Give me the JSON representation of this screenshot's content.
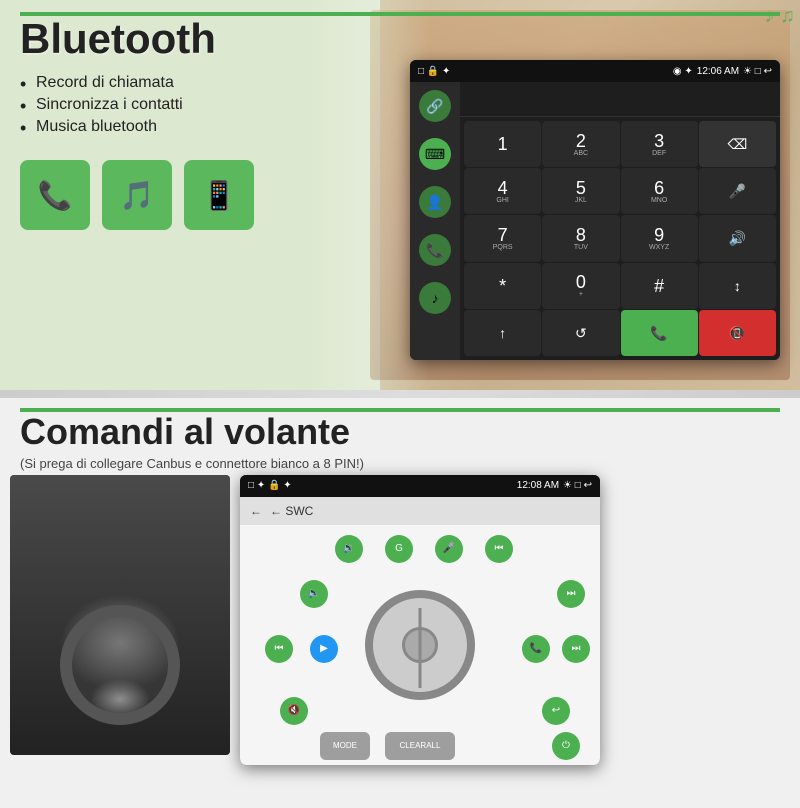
{
  "bluetooth": {
    "title": "Bluetooth",
    "features": [
      "Record di chiamata",
      "Sincronizza i contatti",
      "Musica bluetooth"
    ],
    "icons": [
      "📞",
      "🎵",
      "📱"
    ],
    "phone_status_time": "12:06 AM",
    "phone_status_left": "□ 🔒 ✦",
    "phone_status_right": "◉ ✦ ☀ □ ↩",
    "keypad": [
      {
        "num": "1",
        "sub": ""
      },
      {
        "num": "2",
        "sub": "ABC"
      },
      {
        "num": "3",
        "sub": "DEF"
      },
      {
        "num": "⌫",
        "sub": "",
        "type": "del"
      },
      {
        "num": "4",
        "sub": "GHI"
      },
      {
        "num": "5",
        "sub": "JKL"
      },
      {
        "num": "6",
        "sub": "MNO"
      },
      {
        "num": "🎤",
        "sub": "",
        "type": "special"
      },
      {
        "num": "7",
        "sub": "PQRS"
      },
      {
        "num": "8",
        "sub": "TUV"
      },
      {
        "num": "9",
        "sub": "WXYZ"
      },
      {
        "num": "🔊",
        "sub": "",
        "type": "special"
      },
      {
        "num": "*",
        "sub": ""
      },
      {
        "num": "0",
        "sub": "+"
      },
      {
        "num": "#",
        "sub": ""
      },
      {
        "num": "↕",
        "sub": "",
        "type": "special"
      },
      {
        "num": "↑",
        "sub": ""
      },
      {
        "num": "↺",
        "sub": ""
      },
      {
        "num": "📞",
        "sub": "",
        "type": "green"
      },
      {
        "num": "📵",
        "sub": "",
        "type": "red"
      }
    ]
  },
  "volante": {
    "title": "Comandi al volante",
    "subtitle": "(Si prega di collegare Canbus e connettore bianco a 8 PIN!)",
    "phone_status_time": "12:08 AM",
    "phone_status_left": "□ ✦ 🔒 ✦",
    "swc_label": "← SWC",
    "clearall_label": "CLEARALL",
    "mode_label": "MODE",
    "controls": [
      {
        "label": "🔉",
        "pos": "top-1"
      },
      {
        "label": "GPS",
        "pos": "top-2"
      },
      {
        "label": "🎤",
        "pos": "top-3"
      },
      {
        "label": "⏮",
        "pos": "top-4"
      },
      {
        "label": "🔈",
        "pos": "mid-left-1"
      },
      {
        "label": "⏭",
        "pos": "mid-right-1"
      },
      {
        "label": "⏮",
        "pos": "mid-left-2"
      },
      {
        "label": "▶",
        "pos": "center-left",
        "blue": true
      },
      {
        "label": "📞",
        "pos": "center-right"
      },
      {
        "label": "⏭",
        "pos": "mid-right-2"
      },
      {
        "label": "🔇",
        "pos": "bot-left-1"
      },
      {
        "label": "↩",
        "pos": "bot-right-1"
      },
      {
        "label": "MODE",
        "pos": "bot-left-2"
      },
      {
        "label": "⏻",
        "pos": "bot-right-2"
      }
    ]
  }
}
